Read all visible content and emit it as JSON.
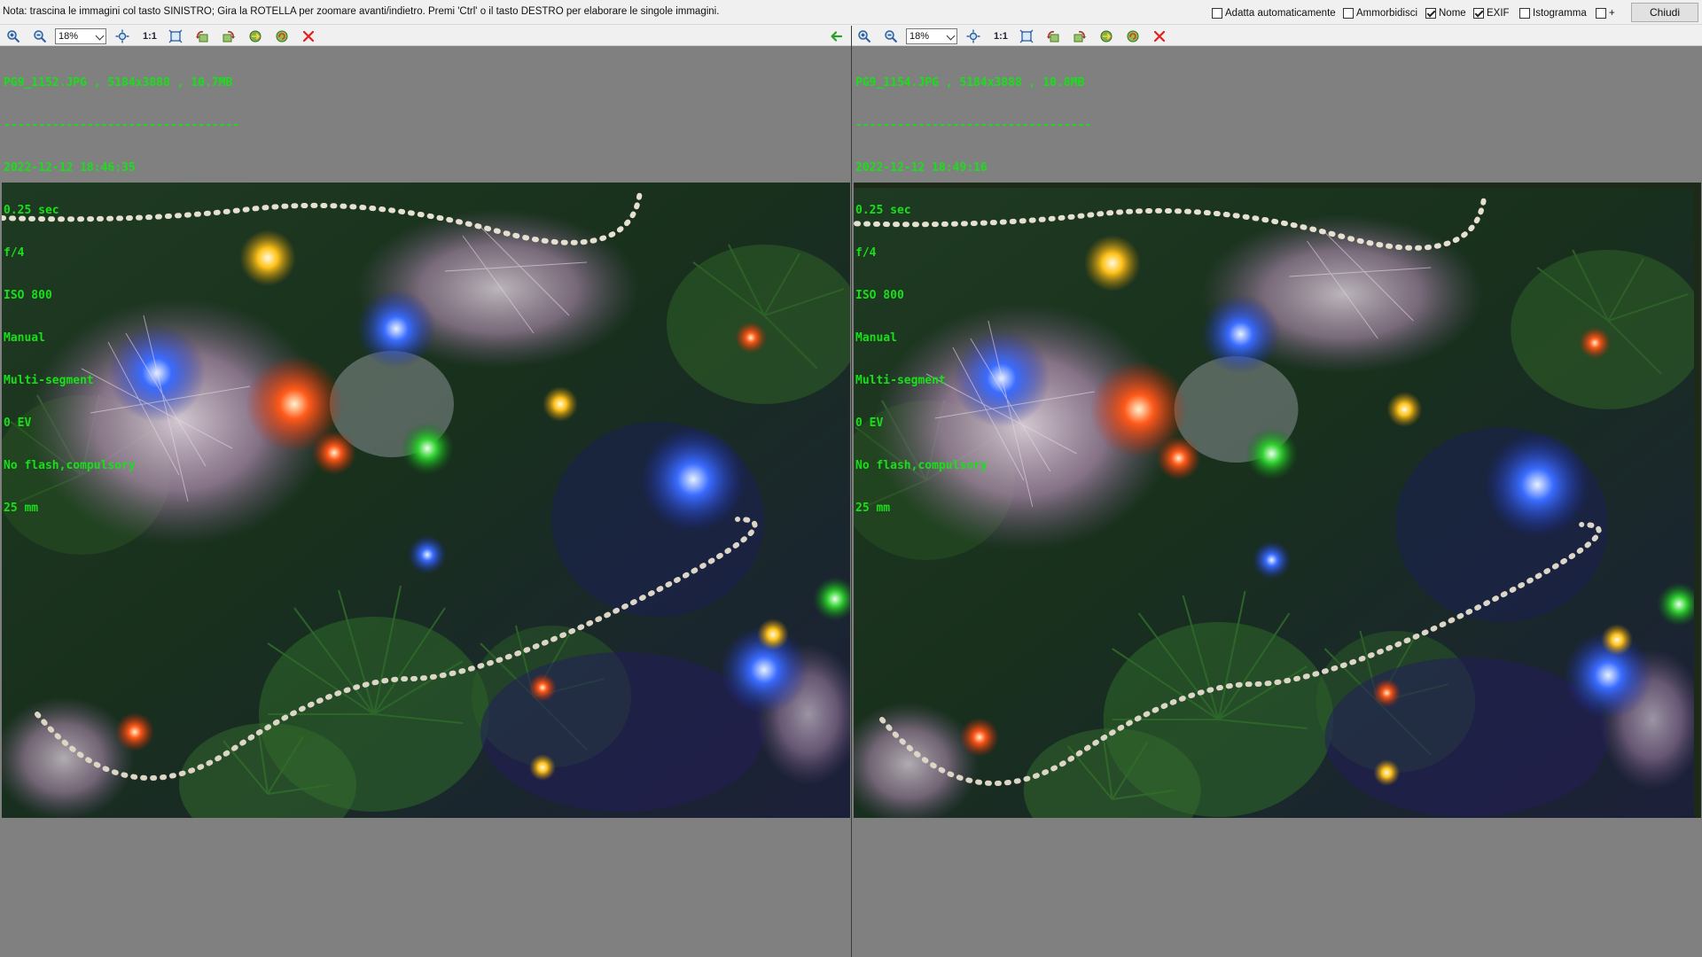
{
  "topbar": {
    "note": "Nota: trascina le immagini col tasto SINISTRO; Gira la ROTELLA per zoomare avanti/indietro. Premi 'Ctrl' o il tasto DESTRO per elaborare le singole immagini.",
    "options": [
      {
        "label": "Adatta automaticamente",
        "checked": false
      },
      {
        "label": "Ammorbidisci",
        "checked": false
      },
      {
        "label": "Nome",
        "checked": true
      },
      {
        "label": "EXIF",
        "checked": true
      },
      {
        "label": "Istogramma",
        "checked": false
      },
      {
        "label": "+",
        "checked": false
      }
    ],
    "close_label": "Chiudi"
  },
  "toolbar": {
    "zoom_value": "18%",
    "one_to_one_label": "1:1",
    "icons": [
      "zoom-in-icon",
      "zoom-out-icon",
      "fit-icon",
      "fit-window-icon",
      "rotate-left-icon",
      "rotate-right-icon",
      "flip-icon",
      "refresh-icon",
      "close-x-icon",
      "back-arrow-icon"
    ]
  },
  "left": {
    "filename_line": "PG9_1152.JPG , 5184x3888 , 10.7MB",
    "separator": "----------------------------------",
    "datetime": "2022-12-12 18:46:35",
    "exposure": "0.25 sec",
    "aperture": "f/4",
    "iso": "ISO 800",
    "mode": "Manual",
    "metering": "Multi-segment",
    "ev": "0 EV",
    "flash": "No flash,compulsory",
    "focal": "25 mm"
  },
  "right": {
    "filename_line": "PG9_1154.JPG , 5184x3888 , 10.8MB",
    "separator": "----------------------------------",
    "datetime": "2022-12-12 18:49:16",
    "exposure": "0.25 sec",
    "aperture": "f/4",
    "iso": "ISO 800",
    "mode": "Manual",
    "metering": "Multi-segment",
    "ev": "0 EV",
    "flash": "No flash,compulsory",
    "focal": "25 mm"
  },
  "colors": {
    "panel_bg": "#808080",
    "exif_text": "#18e018",
    "toolbar_bg": "#f0f0f0",
    "close_icon": "#e02020",
    "back_arrow": "#2aa02a"
  }
}
